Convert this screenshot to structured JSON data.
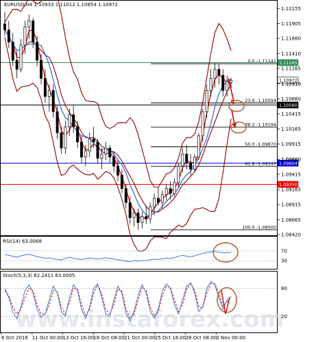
{
  "chart_data": {
    "type": "candlestick",
    "header": "EURUSD,H4  1.10933 1.11012 1.10854 1.10972",
    "symbol": "EURUSD",
    "timeframe": "H4",
    "ohlc_readout": {
      "open": 1.10933,
      "high": 1.11012,
      "low": 1.10854,
      "close": 1.10972
    },
    "price_axis": {
      "ylim": [
        1.0842,
        1.1226
      ],
      "ticks": [
        "1.12155",
        "1.11905",
        "1.11660",
        "1.11410",
        "1.11165",
        "1.10910",
        "1.10660",
        "1.10415",
        "1.10165",
        "1.09915",
        "1.09660",
        "1.09415",
        "1.09165",
        "1.08915",
        "1.08665",
        "1.08420"
      ]
    },
    "x_ticks": [
      "6 Oct 2016",
      "11 Oct 00:00",
      "13 Oct 16:00",
      "18 Oct 08:00",
      "21 Oct 00:00",
      "25 Oct 16:00",
      "28 Oct 08:00",
      "2 Nov 00:00"
    ],
    "candles": [
      {
        "o": 1.119,
        "h": 1.121,
        "l": 1.117,
        "c": 1.118
      },
      {
        "o": 1.118,
        "h": 1.1195,
        "l": 1.115,
        "c": 1.116
      },
      {
        "o": 1.116,
        "h": 1.1175,
        "l": 1.112,
        "c": 1.113
      },
      {
        "o": 1.113,
        "h": 1.1145,
        "l": 1.11,
        "c": 1.1115
      },
      {
        "o": 1.1115,
        "h": 1.1165,
        "l": 1.111,
        "c": 1.1155
      },
      {
        "o": 1.1155,
        "h": 1.1195,
        "l": 1.114,
        "c": 1.1185
      },
      {
        "o": 1.1185,
        "h": 1.1205,
        "l": 1.1165,
        "c": 1.1195
      },
      {
        "o": 1.1195,
        "h": 1.12,
        "l": 1.115,
        "c": 1.116
      },
      {
        "o": 1.116,
        "h": 1.117,
        "l": 1.112,
        "c": 1.113
      },
      {
        "o": 1.113,
        "h": 1.114,
        "l": 1.109,
        "c": 1.11
      },
      {
        "o": 1.11,
        "h": 1.1115,
        "l": 1.106,
        "c": 1.107
      },
      {
        "o": 1.107,
        "h": 1.109,
        "l": 1.1045,
        "c": 1.108
      },
      {
        "o": 1.108,
        "h": 1.109,
        "l": 1.1035,
        "c": 1.1045
      },
      {
        "o": 1.1045,
        "h": 1.1055,
        "l": 1.1,
        "c": 1.101
      },
      {
        "o": 1.101,
        "h": 1.102,
        "l": 1.0975,
        "c": 1.0985
      },
      {
        "o": 1.0985,
        "h": 1.103,
        "l": 1.0975,
        "c": 1.102
      },
      {
        "o": 1.102,
        "h": 1.105,
        "l": 1.1005,
        "c": 1.104
      },
      {
        "o": 1.104,
        "h": 1.1055,
        "l": 1.101,
        "c": 1.102
      },
      {
        "o": 1.102,
        "h": 1.103,
        "l": 1.0985,
        "c": 1.0995
      },
      {
        "o": 1.0995,
        "h": 1.1005,
        "l": 1.096,
        "c": 1.097
      },
      {
        "o": 1.097,
        "h": 1.099,
        "l": 1.0955,
        "c": 1.098
      },
      {
        "o": 1.098,
        "h": 1.101,
        "l": 1.097,
        "c": 1.1
      },
      {
        "o": 1.1,
        "h": 1.102,
        "l": 1.0985,
        "c": 1.0995
      },
      {
        "o": 1.0995,
        "h": 1.1,
        "l": 1.096,
        "c": 1.0968
      },
      {
        "o": 1.0968,
        "h": 1.0985,
        "l": 1.095,
        "c": 1.0975
      },
      {
        "o": 1.0975,
        "h": 1.0995,
        "l": 1.0965,
        "c": 1.0985
      },
      {
        "o": 1.0985,
        "h": 1.099,
        "l": 1.096,
        "c": 1.097
      },
      {
        "o": 1.097,
        "h": 1.098,
        "l": 1.0945,
        "c": 1.0955
      },
      {
        "o": 1.0955,
        "h": 1.0965,
        "l": 1.093,
        "c": 1.094
      },
      {
        "o": 1.094,
        "h": 1.095,
        "l": 1.091,
        "c": 1.0918
      },
      {
        "o": 1.0918,
        "h": 1.0925,
        "l": 1.0885,
        "c": 1.0895
      },
      {
        "o": 1.0895,
        "h": 1.0905,
        "l": 1.086,
        "c": 1.087
      },
      {
        "o": 1.087,
        "h": 1.0885,
        "l": 1.0855,
        "c": 1.0878
      },
      {
        "o": 1.0878,
        "h": 1.0885,
        "l": 1.085,
        "c": 1.0862
      },
      {
        "o": 1.0862,
        "h": 1.088,
        "l": 1.0852,
        "c": 1.0872
      },
      {
        "o": 1.0872,
        "h": 1.089,
        "l": 1.086,
        "c": 1.0868
      },
      {
        "o": 1.0868,
        "h": 1.0895,
        "l": 1.086,
        "c": 1.0888
      },
      {
        "o": 1.0888,
        "h": 1.091,
        "l": 1.0875,
        "c": 1.0902
      },
      {
        "o": 1.0902,
        "h": 1.092,
        "l": 1.089,
        "c": 1.0895
      },
      {
        "o": 1.0895,
        "h": 1.0915,
        "l": 1.0885,
        "c": 1.0908
      },
      {
        "o": 1.0908,
        "h": 1.0925,
        "l": 1.0898,
        "c": 1.0918
      },
      {
        "o": 1.0918,
        "h": 1.093,
        "l": 1.09,
        "c": 1.091
      },
      {
        "o": 1.091,
        "h": 1.0935,
        "l": 1.0905,
        "c": 1.0928
      },
      {
        "o": 1.0928,
        "h": 1.096,
        "l": 1.092,
        "c": 1.0955
      },
      {
        "o": 1.0955,
        "h": 1.0985,
        "l": 1.0945,
        "c": 1.0975
      },
      {
        "o": 1.0975,
        "h": 1.099,
        "l": 1.095,
        "c": 1.096
      },
      {
        "o": 1.096,
        "h": 1.0975,
        "l": 1.094,
        "c": 1.095
      },
      {
        "o": 1.095,
        "h": 1.0975,
        "l": 1.0945,
        "c": 1.097
      },
      {
        "o": 1.097,
        "h": 1.101,
        "l": 1.0965,
        "c": 1.1005
      },
      {
        "o": 1.1005,
        "h": 1.105,
        "l": 1.0995,
        "c": 1.1045
      },
      {
        "o": 1.1045,
        "h": 1.109,
        "l": 1.1035,
        "c": 1.108
      },
      {
        "o": 1.108,
        "h": 1.1115,
        "l": 1.107,
        "c": 1.11
      },
      {
        "o": 1.11,
        "h": 1.1125,
        "l": 1.1085,
        "c": 1.1115
      },
      {
        "o": 1.1115,
        "h": 1.1124,
        "l": 1.109,
        "c": 1.1105
      },
      {
        "o": 1.1105,
        "h": 1.1115,
        "l": 1.107,
        "c": 1.108
      },
      {
        "o": 1.108,
        "h": 1.1105,
        "l": 1.107,
        "c": 1.1095
      },
      {
        "o": 1.1093,
        "h": 1.1101,
        "l": 1.1085,
        "c": 1.1097
      }
    ],
    "indicators": {
      "moving_averages": [
        {
          "color": "#e00000"
        },
        {
          "color": "#3a6fd8"
        }
      ],
      "bollinger_color": "#8b0000"
    },
    "levels": [
      {
        "price": 1.1126,
        "label": "1.11265",
        "color": "#2e8b57",
        "bg": "#2e8b57"
      },
      {
        "price": 1.1056,
        "label": "1.10560",
        "color": "#000000",
        "bg": "#000000"
      },
      {
        "price": 1.096,
        "label": "1.09604",
        "color": "#0000cc",
        "bg": "#0000cc"
      },
      {
        "price": 1.0925,
        "label": "1.09250",
        "color": "#ee0000",
        "bg": "#ee0000"
      },
      {
        "price": 1.1097,
        "label": "1.10972",
        "color": "#000000",
        "bg": "#ffffff"
      }
    ],
    "right_labels": [
      "1.10910",
      "1.09660"
    ],
    "fibonacci": [
      {
        "price": 1.11241,
        "label": "0.0 -1.11241"
      },
      {
        "price": 1.10594,
        "label": "23.6 -1.10594"
      },
      {
        "price": 1.10194,
        "label": "38.2 -1.10194"
      },
      {
        "price": 1.0987,
        "label": "50.0 -1.09870"
      },
      {
        "price": 1.09547,
        "label": "61.8 -1.09547"
      },
      {
        "price": 1.085,
        "label": "100.0 -1.08500"
      }
    ],
    "rsi": {
      "label": "RSI(14) 63.0068",
      "ylim": [
        0,
        100
      ],
      "levels": [
        70,
        30
      ],
      "values": [
        55,
        52,
        48,
        45,
        50,
        54,
        56,
        52,
        47,
        44,
        40,
        42,
        38,
        35,
        33,
        40,
        44,
        40,
        37,
        35,
        38,
        41,
        40,
        37,
        39,
        42,
        40,
        37,
        34,
        31,
        28,
        26,
        30,
        28,
        31,
        30,
        34,
        37,
        35,
        38,
        41,
        39,
        43,
        48,
        52,
        48,
        46,
        50,
        55,
        60,
        64,
        66,
        68,
        65,
        62,
        63,
        63
      ]
    },
    "stochastic": {
      "label": "Stoch(5,3,3) 62.2411 63.0005",
      "ylim": [
        0,
        100
      ],
      "levels": [
        80,
        20
      ],
      "main": [
        80,
        60,
        30,
        15,
        40,
        75,
        88,
        70,
        35,
        18,
        25,
        55,
        85,
        70,
        30,
        20,
        60,
        88,
        75,
        35,
        15,
        40,
        80,
        90,
        60,
        25,
        20,
        55,
        85,
        70,
        25,
        10,
        30,
        65,
        88,
        70,
        30,
        15,
        35,
        75,
        90,
        80,
        45,
        25,
        55,
        85,
        92,
        70,
        30,
        40,
        80,
        95,
        88,
        60,
        35,
        55,
        62
      ],
      "signal": [
        75,
        65,
        40,
        25,
        35,
        60,
        80,
        75,
        45,
        25,
        25,
        45,
        75,
        72,
        40,
        25,
        50,
        80,
        78,
        45,
        22,
        35,
        70,
        88,
        68,
        35,
        25,
        45,
        78,
        74,
        35,
        15,
        25,
        55,
        82,
        75,
        40,
        20,
        30,
        65,
        85,
        82,
        55,
        30,
        45,
        78,
        90,
        76,
        40,
        38,
        70,
        90,
        90,
        68,
        42,
        50,
        63
      ]
    },
    "watermark": "www.instaforex.com"
  }
}
